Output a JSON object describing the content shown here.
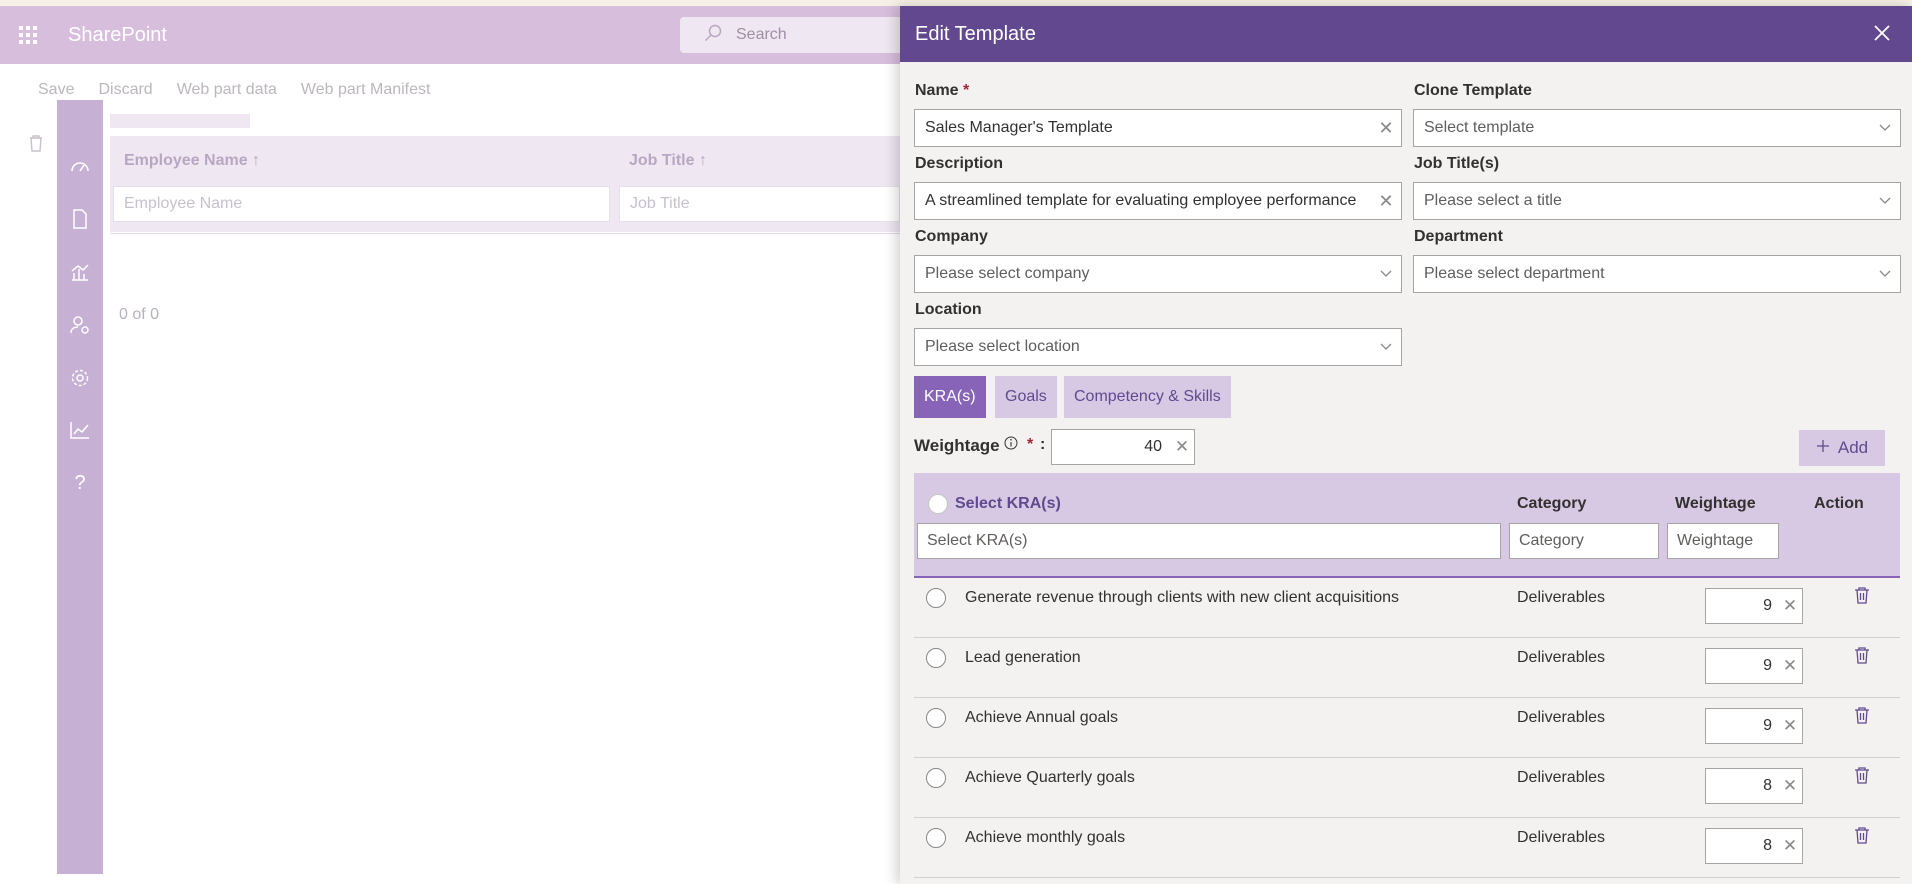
{
  "suite": {
    "app_name": "SharePoint",
    "search_placeholder": "Search"
  },
  "command_bar": {
    "save": "Save",
    "discard": "Discard",
    "web_part_data": "Web part data",
    "web_part_manifest": "Web part Manifest"
  },
  "background": {
    "columns": [
      "Employee Name ↑",
      "Job Title ↑"
    ],
    "filters": [
      "Employee Name",
      "Job Title"
    ],
    "pager": "0 of 0"
  },
  "panel": {
    "title": "Edit Template",
    "close_icon": "close-icon",
    "name_label": "Name",
    "name_value": "Sales Manager's Template",
    "clone_label": "Clone Template",
    "clone_placeholder": "Select template",
    "description_label": "Description",
    "description_value": "A streamlined template for evaluating employee performance",
    "job_titles_label": "Job Title(s)",
    "job_titles_placeholder": "Please select a title",
    "company_label": "Company",
    "company_placeholder": "Please select company",
    "department_label": "Department",
    "department_placeholder": "Please select department",
    "location_label": "Location",
    "location_placeholder": "Please select location",
    "required_mark": "*"
  },
  "tabs": [
    {
      "label": "KRA(s)",
      "active": true
    },
    {
      "label": "Goals",
      "active": false
    },
    {
      "label": "Competency & Skills",
      "active": false
    }
  ],
  "weightage": {
    "label": "Weightage",
    "value": "40",
    "colon": ":",
    "add_label": "Add"
  },
  "kra_table": {
    "headers": {
      "select": "Select KRA(s)",
      "category": "Category",
      "weightage": "Weightage",
      "action": "Action"
    },
    "filters": {
      "select": "Select KRA(s)",
      "category": "Category",
      "weightage": "Weightage"
    },
    "rows": [
      {
        "name": "Generate revenue through clients with new client acquisitions",
        "category": "Deliverables",
        "weightage": "9"
      },
      {
        "name": "Lead generation",
        "category": "Deliverables",
        "weightage": "9"
      },
      {
        "name": "Achieve Annual goals",
        "category": "Deliverables",
        "weightage": "9"
      },
      {
        "name": "Achieve Quarterly goals",
        "category": "Deliverables",
        "weightage": "8"
      },
      {
        "name": "Achieve monthly goals",
        "category": "Deliverables",
        "weightage": "8"
      }
    ]
  },
  "colors": {
    "panel_header": "#62498f",
    "accent": "#8764b8",
    "suite_bar": "#d7bedc",
    "rail": "#c6b0d3"
  }
}
